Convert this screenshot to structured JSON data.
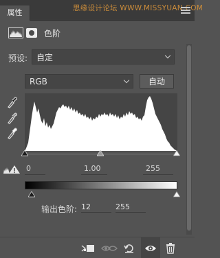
{
  "panel": {
    "tab_label": "属性",
    "watermark": "思缘设计论坛 WWW.MISSYUAN.COM",
    "title": "色阶"
  },
  "preset": {
    "label": "预设:",
    "value": "自定"
  },
  "channel": {
    "value": "RGB",
    "auto_label": "自动"
  },
  "input_levels": {
    "black": "0",
    "gamma": "1.00",
    "white": "255"
  },
  "output_levels": {
    "label": "输出色阶:",
    "black": "12",
    "white": "255"
  },
  "footer": {
    "icons": [
      "clip-to-layer-icon",
      "view-previous-state-icon",
      "reset-icon",
      "visibility-eye-icon",
      "delete-trash-icon"
    ]
  },
  "colors": {
    "panel_bg": "#535353",
    "titlebar_bg": "#3a3a3a",
    "field_bg": "#454545",
    "histogram_fill": "#ffffff",
    "watermark": "#c98b3a"
  }
}
